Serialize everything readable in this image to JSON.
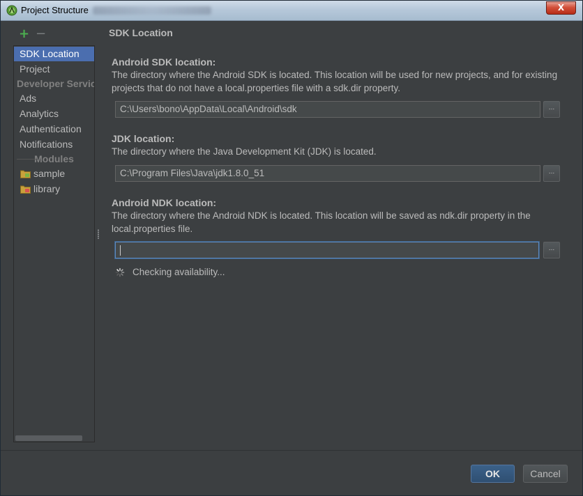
{
  "window": {
    "title": "Project Structure",
    "close_label": "X"
  },
  "toolbar": {
    "add_label": "+",
    "remove_label": "−"
  },
  "sidebar": {
    "items": [
      {
        "label": "SDK Location",
        "selected": true
      },
      {
        "label": "Project",
        "selected": false
      }
    ],
    "developer_services_header": "Developer Services",
    "services": [
      {
        "label": "Ads"
      },
      {
        "label": "Analytics"
      },
      {
        "label": "Authentication"
      },
      {
        "label": "Notifications"
      }
    ],
    "modules_header": "Modules",
    "modules": [
      {
        "label": "sample",
        "icon": "android-module-folder-icon"
      },
      {
        "label": "library",
        "icon": "library-module-folder-icon"
      }
    ]
  },
  "content": {
    "title": "SDK Location",
    "sdk": {
      "title": "Android SDK location:",
      "description": "The directory where the Android SDK is located. This location will be used for new projects, and for existing projects that do not have a local.properties file with a sdk.dir property.",
      "value": "C:\\Users\\bono\\AppData\\Local\\Android\\sdk",
      "browse_label": "..."
    },
    "jdk": {
      "title": "JDK location:",
      "description": "The directory where the Java Development Kit (JDK) is located.",
      "value": "C:\\Program Files\\Java\\jdk1.8.0_51",
      "browse_label": "..."
    },
    "ndk": {
      "title": "Android NDK location:",
      "description": "The directory where the Android NDK is located. This location will be saved as ndk.dir property in the local.properties file.",
      "value": "",
      "browse_label": "..."
    },
    "status": "Checking availability..."
  },
  "buttons": {
    "ok": "OK",
    "cancel": "Cancel"
  },
  "colors": {
    "background": "#3c3f41",
    "selection": "#4b6eaf",
    "text": "#bbbbbb",
    "add": "#4caf50",
    "ok_button": "#365880"
  }
}
